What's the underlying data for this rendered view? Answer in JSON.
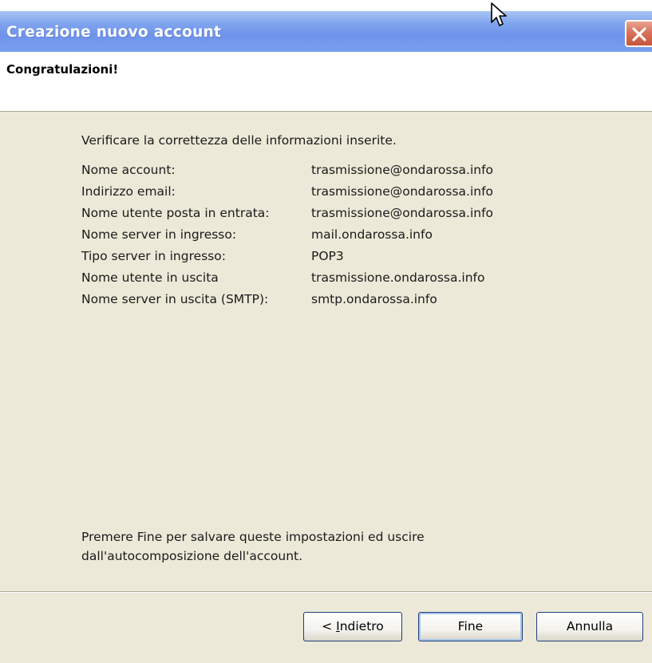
{
  "window": {
    "title": "Creazione nuovo account"
  },
  "header": {
    "title": "Congratulazioni!"
  },
  "content": {
    "intro": "Verificare la correttezza delle informazioni inserite.",
    "rows": [
      {
        "label": "Nome account:",
        "value": "trasmissione@ondarossa.info"
      },
      {
        "label": "Indirizzo email:",
        "value": "trasmissione@ondarossa.info"
      },
      {
        "label": "Nome utente posta in entrata:",
        "value": "trasmissione@ondarossa.info"
      },
      {
        "label": "Nome server in ingresso:",
        "value": "mail.ondarossa.info"
      },
      {
        "label": "Tipo server in ingresso:",
        "value": "POP3"
      },
      {
        "label": "Nome utente in uscita",
        "value": "trasmissione.ondarossa.info"
      },
      {
        "label": "Nome server in uscita (SMTP):",
        "value": "smtp.ondarossa.info"
      }
    ],
    "footer_line1": "Premere Fine per salvare queste impostazioni ed uscire",
    "footer_line2": "dall'autocomposizione dell'account."
  },
  "buttons": {
    "back_prefix": "< ",
    "back_mnemonic": "I",
    "back_rest": "ndietro",
    "finish": "Fine",
    "cancel": "Annulla"
  },
  "icons": {
    "close": "close-icon",
    "cursor": "mouse-pointer-icon"
  },
  "colors": {
    "titlebar": "#7fa4ee",
    "dialog_bg": "#ece9d8",
    "close_button": "#d8725a"
  }
}
